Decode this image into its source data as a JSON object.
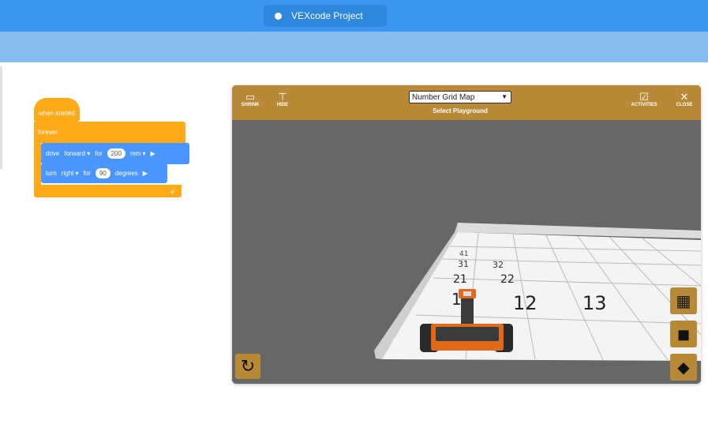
{
  "app": {
    "title": "VEXcode Project"
  },
  "blocks": {
    "hat": "when started",
    "forever": "forever",
    "drive": {
      "label": "drive",
      "direction": "forward ▾",
      "for_label": "for",
      "value": "200",
      "unit": "mm ▾"
    },
    "turn": {
      "label": "turn",
      "direction": "right ▾",
      "for_label": "for",
      "value": "90",
      "unit": "degrees"
    }
  },
  "playground": {
    "shrink_label": "SHRINK",
    "hide_label": "HIDE",
    "map_select": "Number Grid Map",
    "select_label": "Select Playground",
    "activities_label": "ACTIVITIES",
    "close_label": "CLOSE",
    "grid_numbers": {
      "r41": "41",
      "r31": "31",
      "r32": "32",
      "r21": "21",
      "r22": "22",
      "r11": "1",
      "r12": "12",
      "r13": "13"
    }
  },
  "colors": {
    "topbar": "#3a96ef",
    "subbar": "#88bdf0",
    "events": "#ffab19",
    "motion": "#4c97ff",
    "playground_header": "#b88a37"
  }
}
